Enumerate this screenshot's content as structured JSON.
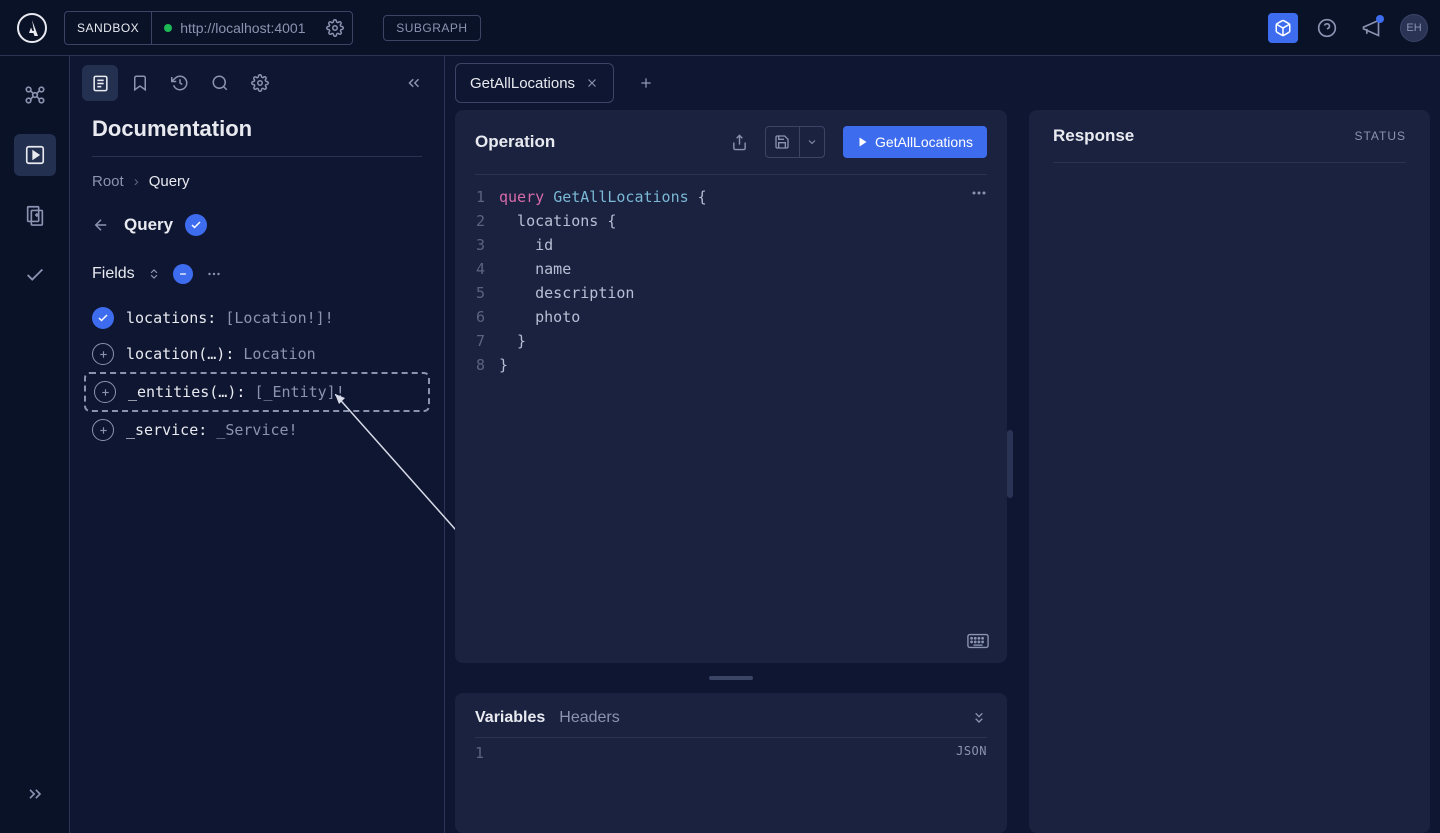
{
  "topbar": {
    "sandbox_label": "SANDBOX",
    "url": "http://localhost:4001",
    "subgraph_label": "SUBGRAPH",
    "avatar": "EH"
  },
  "sidebar": {
    "title": "Documentation",
    "breadcrumb": {
      "root": "Root",
      "current": "Query"
    },
    "page": {
      "title": "Query"
    },
    "fields_label": "Fields",
    "fields": [
      {
        "name": "locations:",
        "type": "[Location!]!",
        "checked": true
      },
      {
        "name": "location(…):",
        "type": "Location",
        "checked": false
      },
      {
        "name": "_entities(…):",
        "type": "[_Entity]!",
        "checked": false,
        "highlighted": true
      },
      {
        "name": "_service:",
        "type": "_Service!",
        "checked": false
      }
    ]
  },
  "tabs": {
    "active": "GetAllLocations"
  },
  "operation": {
    "title": "Operation",
    "run_label": "GetAllLocations",
    "code": {
      "lines": [
        "1",
        "2",
        "3",
        "4",
        "5",
        "6",
        "7",
        "8"
      ],
      "l1_kw": "query",
      "l1_nm": "GetAllLocations",
      "l1_rest": " {",
      "l2": "  locations {",
      "l3": "    id",
      "l4": "    name",
      "l5": "    description",
      "l6": "    photo",
      "l7": "  }",
      "l8": "}"
    }
  },
  "variables": {
    "tab_variables": "Variables",
    "tab_headers": "Headers",
    "line1": "1",
    "json_label": "JSON"
  },
  "response": {
    "title": "Response",
    "status_label": "STATUS"
  }
}
